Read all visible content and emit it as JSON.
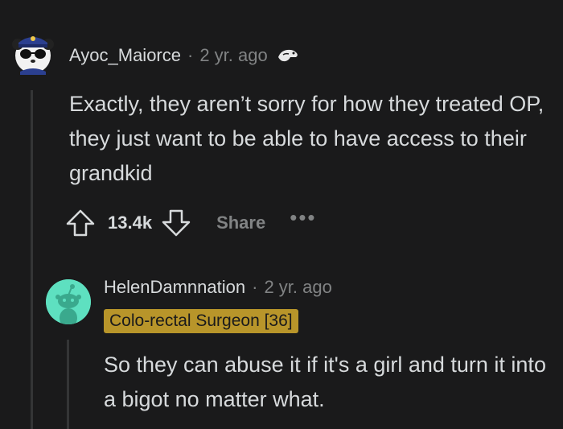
{
  "comments": [
    {
      "author": "Ayoc_Maiorce",
      "separator": "·",
      "time": "2 yr. ago",
      "award_icon": "award-hand-icon",
      "avatar_icon": "panda-sailor-avatar-icon",
      "body": "Exactly, they aren’t sorry for how they treated OP, they just want to be able to have access to their grandkid",
      "actions": {
        "upvote_icon": "upvote-arrow-icon",
        "score": "13.4k",
        "downvote_icon": "downvote-arrow-icon",
        "share_label": "Share",
        "more_label": "•••"
      }
    },
    {
      "author": "HelenDamnnation",
      "separator": "·",
      "time": "2 yr. ago",
      "avatar_icon": "snoo-avatar-icon",
      "flair": "Colo-rectal Surgeon [36]",
      "body": "So they can abuse it if it's a girl and turn it into a bigot no matter what."
    }
  ],
  "colors": {
    "background": "#1a1a1b",
    "text": "#d7dadc",
    "muted": "#818384",
    "flair_bg": "#b8952a",
    "avatar2_bg": "#5ee0c0"
  }
}
